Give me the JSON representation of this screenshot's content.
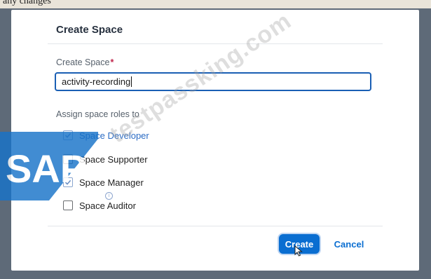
{
  "top_caption": "any changes",
  "dialog": {
    "title": "Create Space",
    "field_label": "Create Space",
    "required_mark": "*",
    "input_value": "activity-recording",
    "roles_label": "Assign space roles to",
    "roles": [
      {
        "label": "Space Developer",
        "checked": true
      },
      {
        "label": "Space Supporter",
        "checked": false
      },
      {
        "label": "Space Manager",
        "checked": true
      },
      {
        "label": "Space Auditor",
        "checked": false
      }
    ],
    "create_label": "Create",
    "cancel_label": "Cancel"
  },
  "logo_text": "SAP",
  "watermark": "testpassking.com",
  "colors": {
    "accent": "#0a6ed1",
    "focus_border": "#1a5fb4",
    "required": "#c0254b",
    "logo": "#1873c9"
  },
  "icons": {
    "check": "checkmark-icon",
    "cursor": "mouse-pointer-icon",
    "info": "info-icon"
  }
}
